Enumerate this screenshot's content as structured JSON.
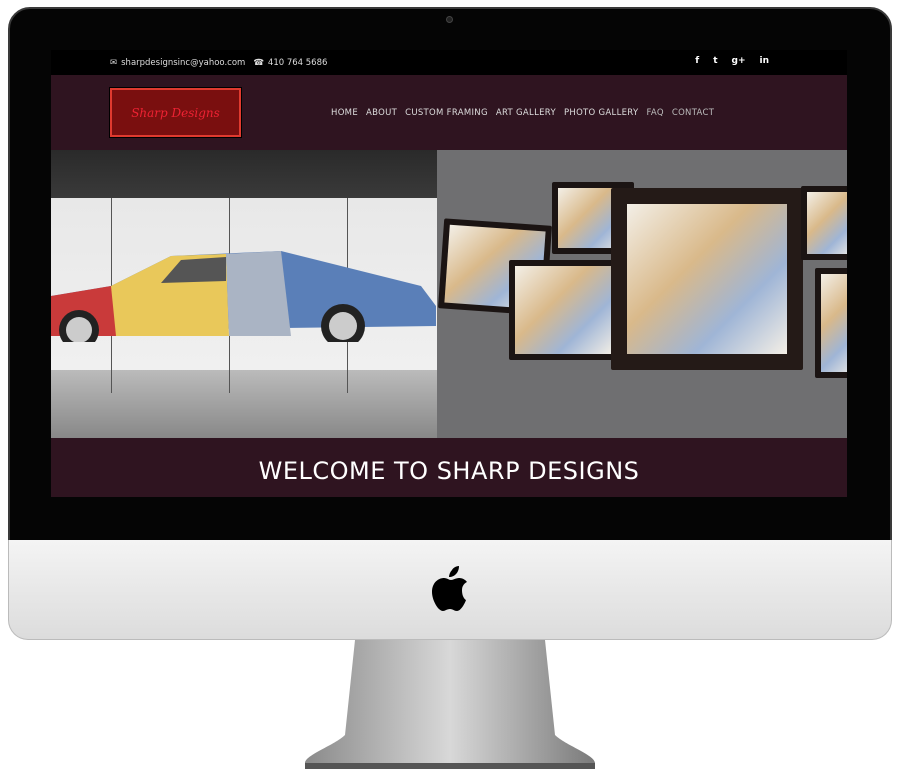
{
  "topbar": {
    "email": "sharpdesignsinc@yahoo.com",
    "phone": "410 764 5686",
    "social": [
      {
        "icon": "facebook-icon",
        "label": "f"
      },
      {
        "icon": "twitter-icon",
        "label": "t"
      },
      {
        "icon": "google-plus-icon",
        "label": "g+"
      },
      {
        "icon": "linkedin-icon",
        "label": "in"
      }
    ]
  },
  "logo": {
    "text": "Sharp Designs"
  },
  "nav": {
    "items": [
      "HOME",
      "ABOUT",
      "CUSTOM FRAMING",
      "ART GALLERY",
      "PHOTO GALLERY",
      "FAQ",
      "CONTACT"
    ]
  },
  "welcome": {
    "title": "WELCOME TO SHARP DESIGNS"
  },
  "colors": {
    "nav_bg": "#2f1420",
    "topbar_bg": "#000000",
    "logo_bg": "#7a0f0f",
    "logo_border": "#e03a2f"
  }
}
